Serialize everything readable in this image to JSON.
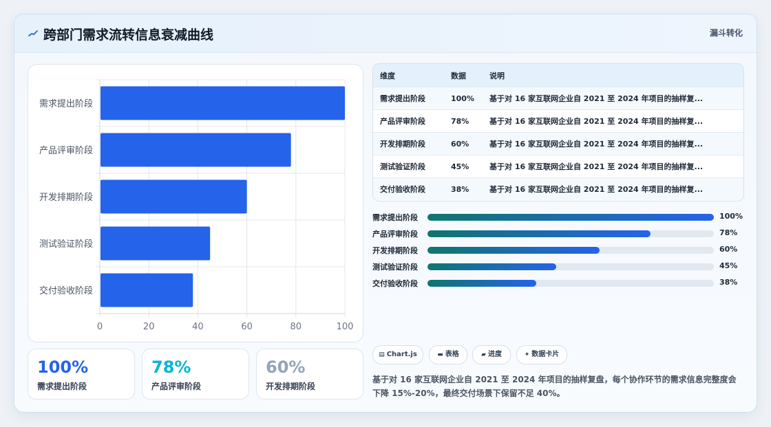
{
  "header": {
    "title": "跨部门需求流转信息衰减曲线",
    "tag": "漏斗转化"
  },
  "colors": {
    "bar": "#2563eb",
    "kpi_1": "#2563eb",
    "kpi_2": "#06b6d4",
    "kpi_3": "#94a3b8",
    "progress_start": "#0f766e",
    "progress_end": "#2563eb"
  },
  "chart_data": {
    "type": "bar",
    "orientation": "horizontal",
    "categories": [
      "需求提出阶段",
      "产品评审阶段",
      "开发排期阶段",
      "测试验证阶段",
      "交付验收阶段"
    ],
    "values": [
      100,
      78,
      60,
      45,
      38
    ],
    "xlim": [
      0,
      100
    ],
    "xticks": [
      0,
      20,
      40,
      60,
      80,
      100
    ],
    "grid": true,
    "legend": "none"
  },
  "kpis": [
    {
      "value": "100%",
      "label": "需求提出阶段"
    },
    {
      "value": "78%",
      "label": "产品评审阶段"
    },
    {
      "value": "60%",
      "label": "开发排期阶段"
    }
  ],
  "table": {
    "headers": [
      "维度",
      "数据",
      "说明"
    ],
    "rows": [
      [
        "需求提出阶段",
        "100%",
        "基于对 16 家互联网企业自 2021 至 2024 年项目的抽样复..."
      ],
      [
        "产品评审阶段",
        "78%",
        "基于对 16 家互联网企业自 2021 至 2024 年项目的抽样复..."
      ],
      [
        "开发排期阶段",
        "60%",
        "基于对 16 家互联网企业自 2021 至 2024 年项目的抽样复..."
      ],
      [
        "测试验证阶段",
        "45%",
        "基于对 16 家互联网企业自 2021 至 2024 年项目的抽样复..."
      ],
      [
        "交付验收阶段",
        "38%",
        "基于对 16 家互联网企业自 2021 至 2024 年项目的抽样复..."
      ]
    ]
  },
  "progress": [
    {
      "label": "需求提出阶段",
      "percent": 100,
      "value": "100%"
    },
    {
      "label": "产品评审阶段",
      "percent": 78,
      "value": "78%"
    },
    {
      "label": "开发排期阶段",
      "percent": 60,
      "value": "60%"
    },
    {
      "label": "测试验证阶段",
      "percent": 45,
      "value": "45%"
    },
    {
      "label": "交付验收阶段",
      "percent": 38,
      "value": "38%"
    }
  ],
  "chips": [
    {
      "icon": "chart-icon",
      "glyph": "▤",
      "label": "Chart.js"
    },
    {
      "icon": "table-icon",
      "glyph": "▬",
      "label": "表格"
    },
    {
      "icon": "progress-icon",
      "glyph": "▰",
      "label": "进度"
    },
    {
      "icon": "card-icon",
      "glyph": "✦",
      "label": "数据卡片"
    }
  ],
  "description": "基于对 16 家互联网企业自 2021 至 2024 年项目的抽样复盘，每个协作环节的需求信息完整度会下降 15%-20%，最终交付场景下保留不足 40%。"
}
